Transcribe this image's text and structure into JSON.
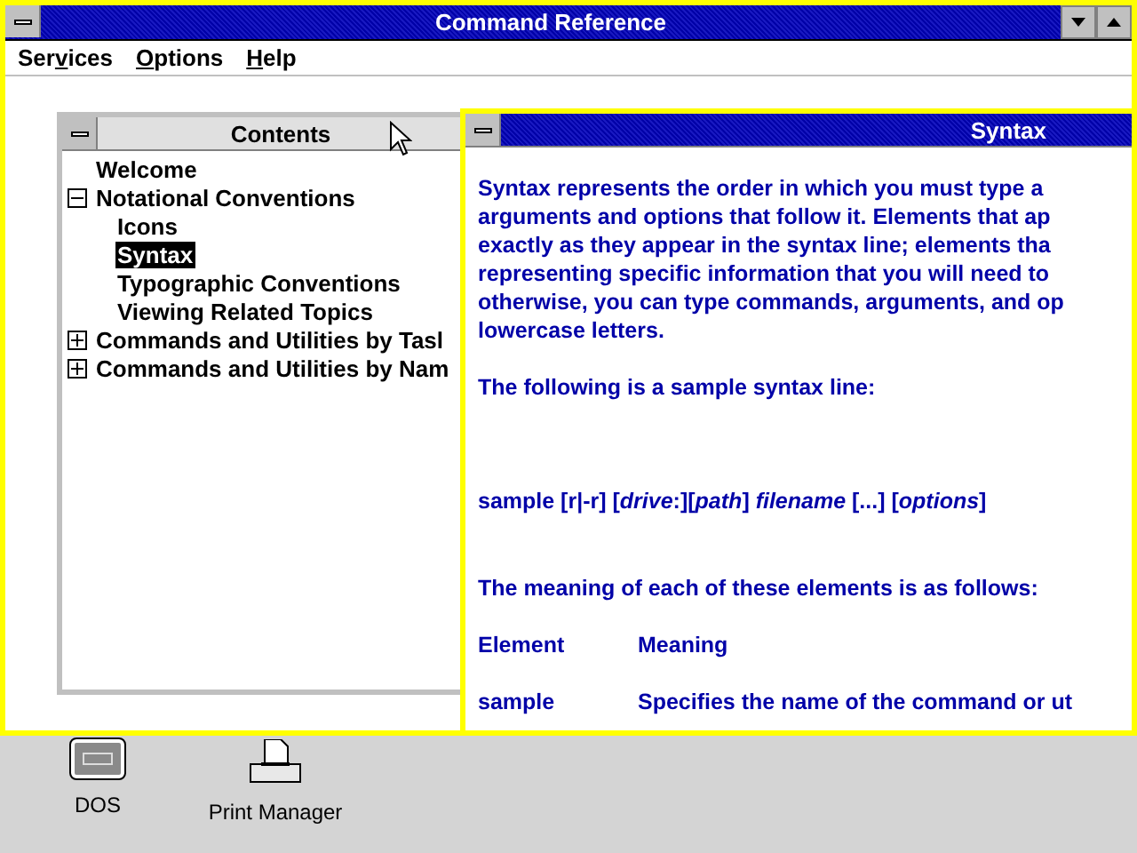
{
  "window": {
    "title": "Command Reference"
  },
  "menu": [
    {
      "before": "Ser",
      "key": "v",
      "after": "ices"
    },
    {
      "key": "O",
      "after": "ptions"
    },
    {
      "key": "H",
      "after": "elp"
    }
  ],
  "contents": {
    "title": "Contents",
    "active": false,
    "items": [
      {
        "label": "Welcome",
        "kind": "topic",
        "selected": false
      },
      {
        "label": "Notational Conventions",
        "kind": "book",
        "expanded": true,
        "selected": false,
        "children": [
          {
            "label": "Icons",
            "kind": "topic",
            "selected": false
          },
          {
            "label": "Syntax",
            "kind": "topic",
            "selected": true
          },
          {
            "label": "Typographic Conventions",
            "kind": "topic",
            "selected": false
          },
          {
            "label": "Viewing Related Topics",
            "kind": "topic",
            "selected": false
          }
        ]
      },
      {
        "label": "Commands and Utilities by Tasl",
        "kind": "book",
        "expanded": false,
        "selected": false
      },
      {
        "label": "Commands and Utilities by Nam",
        "kind": "book",
        "expanded": false,
        "selected": false
      }
    ]
  },
  "topic": {
    "title": "Syntax",
    "active": true,
    "paragraph_lines": [
      "Syntax represents the order in which you must type a",
      "arguments and options that follow it. Elements that ap",
      "exactly as they appear in the syntax line; elements tha",
      "representing specific information that you will need to",
      "otherwise, you can type commands, arguments, and op",
      "lowercase letters."
    ],
    "intro": "The following is a sample syntax line:",
    "sample_line": "sample [r|-r] [*drive*:][*path*] *filename* [...] [*options*]",
    "meaning_intro": "The meaning of each of these elements is as follows:",
    "table": {
      "columns": [
        "Element",
        "Meaning"
      ],
      "rows": [
        [
          "sample",
          "Specifies the name of the command or ut"
        ]
      ]
    }
  },
  "desktop_icons": [
    {
      "label": "DOS",
      "kind": "dos"
    },
    {
      "label": "Print Manager",
      "kind": "printer"
    }
  ]
}
